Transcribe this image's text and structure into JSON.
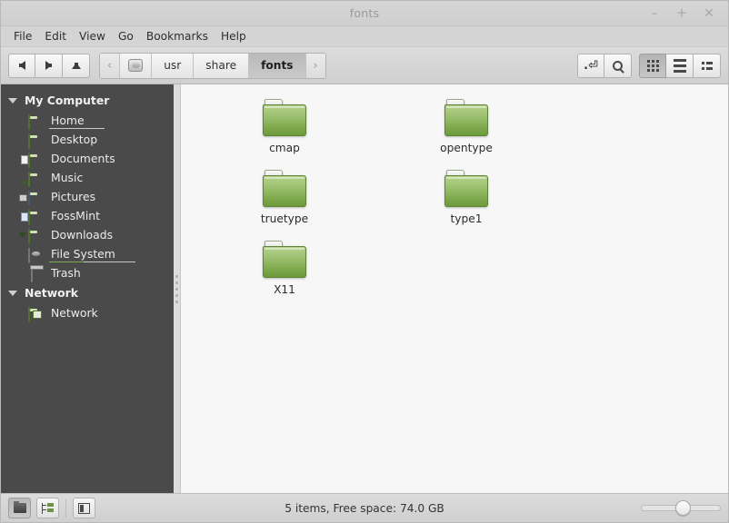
{
  "window": {
    "title": "fonts",
    "controls": {
      "minimize": "–",
      "maximize": "+",
      "close": "✕"
    }
  },
  "menubar": {
    "items": [
      "File",
      "Edit",
      "View",
      "Go",
      "Bookmarks",
      "Help"
    ]
  },
  "toolbar": {
    "nav": [
      {
        "name": "back",
        "icon": "arrow-left-icon"
      },
      {
        "name": "forward",
        "icon": "arrow-right-icon"
      },
      {
        "name": "up",
        "icon": "arrow-up-icon"
      }
    ],
    "breadcrumb": {
      "prev_chevron": "‹",
      "next_chevron": "›",
      "root_icon": "hard-disk-icon",
      "crumbs": [
        {
          "label": "usr",
          "active": false
        },
        {
          "label": "share",
          "active": false
        },
        {
          "label": "fonts",
          "active": true
        }
      ]
    },
    "right_buttons": [
      {
        "name": "toggle-path-entry",
        "icon": "path-entry-icon"
      },
      {
        "name": "search",
        "icon": "search-icon"
      }
    ],
    "view_modes": [
      {
        "name": "icon-view",
        "icon": "grid-icon",
        "active": true
      },
      {
        "name": "list-view",
        "icon": "list-icon",
        "active": false
      },
      {
        "name": "compact-view",
        "icon": "compact-icon",
        "active": false
      }
    ]
  },
  "sidebar": {
    "groups": [
      {
        "label": "My Computer",
        "items": [
          {
            "label": "Home",
            "icon": "home-folder-icon",
            "underlined": true,
            "accent": false
          },
          {
            "label": "Desktop",
            "icon": "desktop-folder-icon",
            "underlined": false
          },
          {
            "label": "Documents",
            "icon": "documents-folder-icon",
            "underlined": false
          },
          {
            "label": "Music",
            "icon": "music-folder-icon",
            "underlined": false
          },
          {
            "label": "Pictures",
            "icon": "pictures-folder-icon",
            "underlined": false
          },
          {
            "label": "FossMint",
            "icon": "fossmint-folder-icon",
            "underlined": false
          },
          {
            "label": "Downloads",
            "icon": "downloads-folder-icon",
            "underlined": false
          },
          {
            "label": "File System",
            "icon": "hard-disk-icon",
            "underlined": true,
            "accent": true
          },
          {
            "label": "Trash",
            "icon": "trash-icon",
            "underlined": false
          }
        ]
      },
      {
        "label": "Network",
        "items": [
          {
            "label": "Network",
            "icon": "network-folder-icon",
            "underlined": false
          }
        ]
      }
    ]
  },
  "content": {
    "files": [
      {
        "name": "cmap",
        "type": "folder"
      },
      {
        "name": "opentype",
        "type": "folder"
      },
      {
        "name": "truetype",
        "type": "folder"
      },
      {
        "name": "type1",
        "type": "folder"
      },
      {
        "name": "X11",
        "type": "folder"
      }
    ]
  },
  "statusbar": {
    "buttons": [
      {
        "name": "icon-pane-button",
        "icon": "folder-icon",
        "active": true
      },
      {
        "name": "tree-pane-button",
        "icon": "tree-icon",
        "active": false
      },
      {
        "name": "toggle-sidebar-button",
        "icon": "side-pane-icon",
        "active": false
      }
    ],
    "text": "5 items, Free space: 74.0 GB",
    "zoom": {
      "value": 52
    }
  },
  "colors": {
    "sidebar_bg": "#4a4a4a",
    "content_bg": "#f7f7f7",
    "chrome_bg": "#d2d2d2",
    "folder_green": "#7ea84c",
    "accent_green": "#8fb85f"
  }
}
